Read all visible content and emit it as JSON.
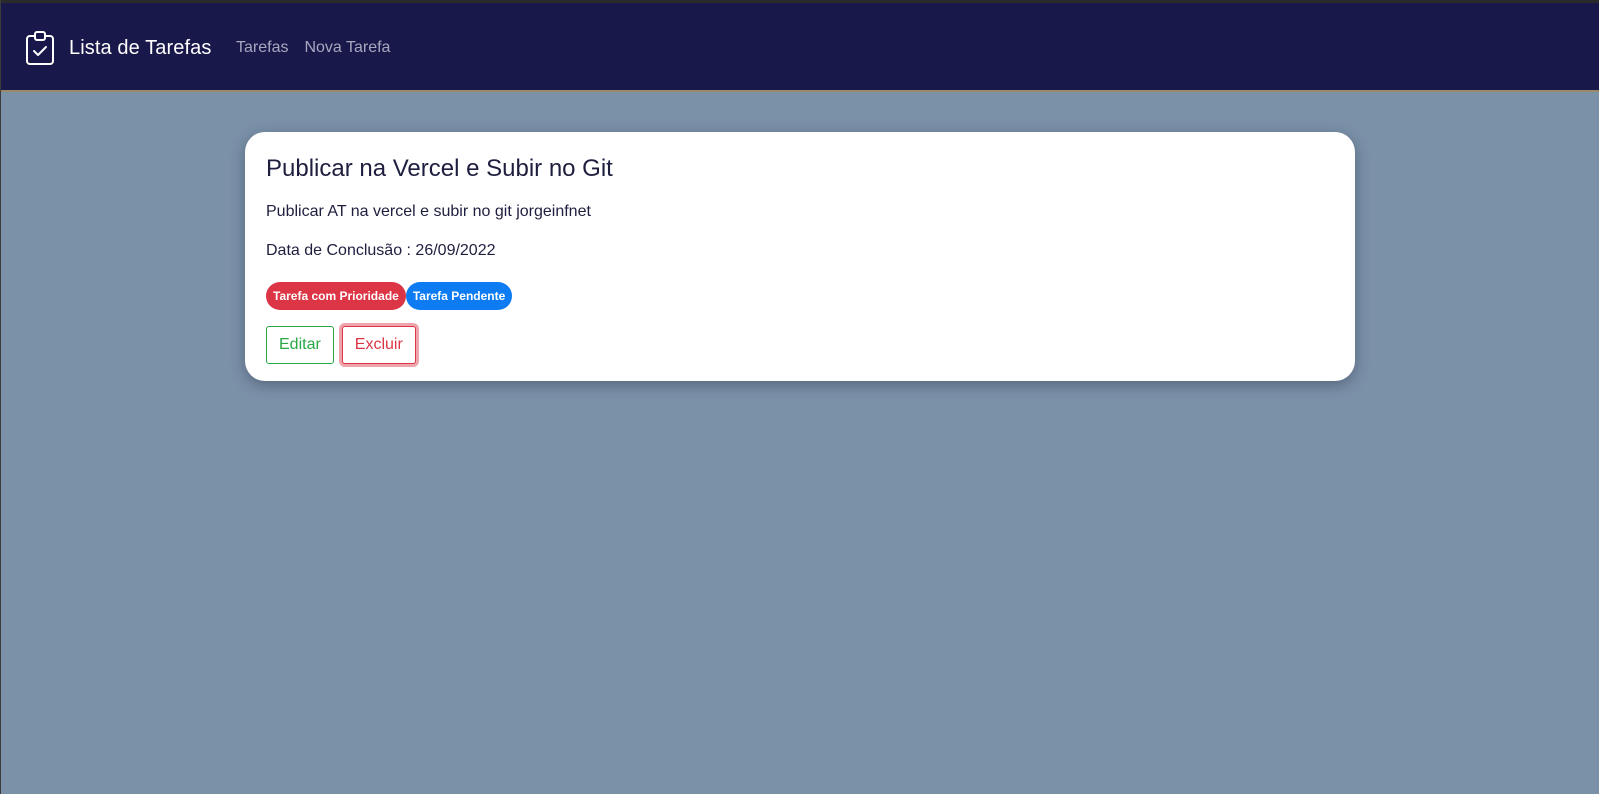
{
  "navbar": {
    "title": "Lista de Tarefas",
    "links": [
      "Tarefas",
      "Nova Tarefa"
    ]
  },
  "task": {
    "title": "Publicar na Vercel e Subir no Git",
    "description": "Publicar AT na vercel e subir no git jorgeinfnet",
    "date_label": "Data de Conclusão : 26/09/2022",
    "badges": {
      "priority": "Tarefa com Prioridade",
      "pending": "Tarefa Pendente"
    },
    "actions": {
      "edit": "Editar",
      "delete": "Excluir"
    }
  },
  "colors": {
    "navbar_bg": "#19184a",
    "page_bg": "#7b91a8",
    "priority_badge": "#dc3545",
    "pending_badge": "#0d7cf2",
    "edit": "#28a745",
    "delete": "#dc3545"
  },
  "icons": {
    "brand": "clipboard-check-icon"
  }
}
